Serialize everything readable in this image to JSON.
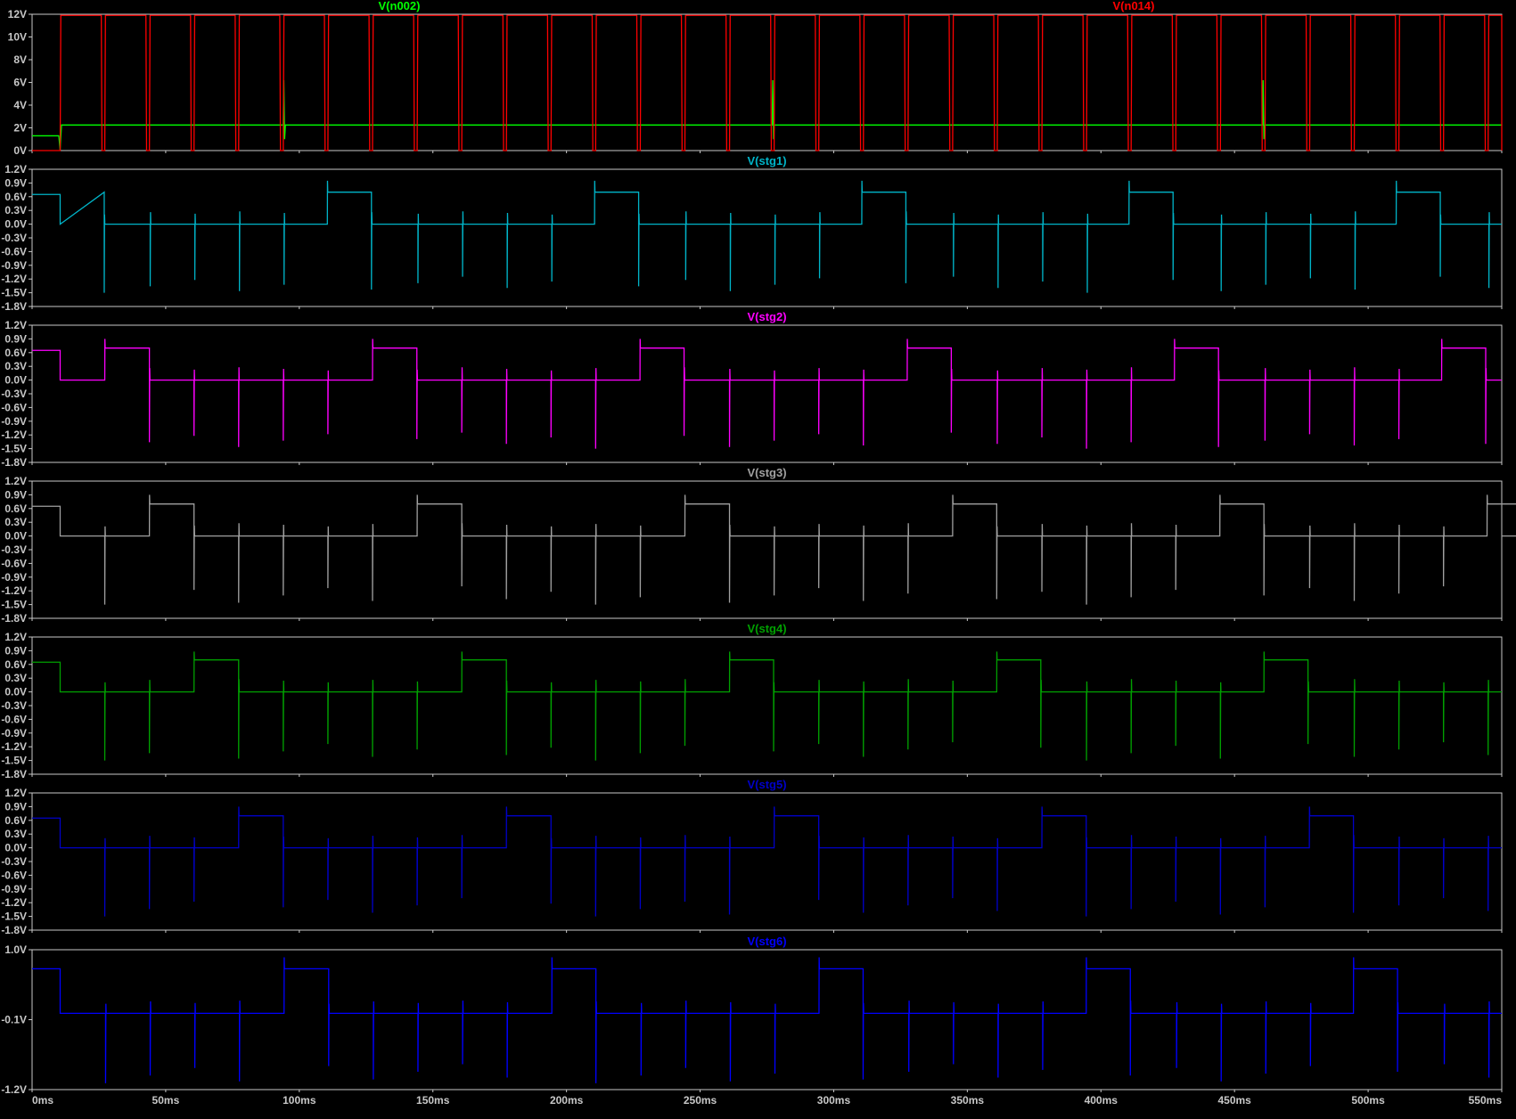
{
  "window": {
    "background": "#000000",
    "frame_color": "#C8C8C8",
    "tick_label_color": "#C8C8C8"
  },
  "chart_data": [
    {
      "type": "line",
      "title": "",
      "xlabel": "",
      "ylabel": "",
      "xlim": [
        0,
        550
      ],
      "ylim": [
        0,
        12
      ],
      "yticks": [
        0,
        2,
        4,
        6,
        8,
        10,
        12
      ],
      "ytick_labels": [
        "0V",
        "2V",
        "4V",
        "6V",
        "8V",
        "10V",
        "12V"
      ],
      "grid": false,
      "legend": "top",
      "series": [
        {
          "name": "V(n002)",
          "color": "#00FF00",
          "points": [
            [
              0,
              1.3
            ],
            [
              10,
              1.3
            ],
            [
              10.5,
              0.05
            ],
            [
              11,
              2.25
            ],
            [
              94,
              2.25
            ],
            [
              94.2,
              6.2
            ],
            [
              94.5,
              1.0
            ],
            [
              94.8,
              2.25
            ],
            [
              277,
              2.25
            ],
            [
              277.2,
              6.2
            ],
            [
              277.5,
              1.0
            ],
            [
              277.8,
              2.25
            ],
            [
              460.5,
              2.25
            ],
            [
              460.7,
              6.2
            ],
            [
              461,
              1.0
            ],
            [
              461.3,
              2.25
            ],
            [
              550,
              2.25
            ]
          ]
        },
        {
          "name": "V(n014)",
          "color": "#FF0000",
          "pulse": {
            "low": 0,
            "high": 11.9,
            "first_rise": 10.5,
            "period": 16.7,
            "width": 15.4,
            "end": 550
          }
        }
      ]
    },
    {
      "type": "line",
      "title": "V(stg1)",
      "xlim": [
        0,
        550
      ],
      "ylim": [
        -1.8,
        1.2
      ],
      "yticks": [
        -1.8,
        -1.5,
        -1.2,
        -0.9,
        -0.6,
        -0.3,
        0.0,
        0.3,
        0.6,
        0.9,
        1.2
      ],
      "ytick_labels": [
        "-1.8V",
        "-1.5V",
        "-1.2V",
        "-0.9V",
        "-0.6V",
        "-0.3V",
        "0.0V",
        "0.3V",
        "0.6V",
        "0.9V",
        "1.2V"
      ],
      "grid": false,
      "series": [
        {
          "name": "V(stg1)",
          "color": "#00B4C8",
          "wave": {
            "baseline": 0.0,
            "pulse_level": 0.7,
            "initial_level": 0.65,
            "initial_end": 10.5,
            "pulse_starts": [
              10.5,
              110.5,
              210.5,
              310.5,
              410.5,
              510.5
            ],
            "pulse_width": 16.5,
            "pulse_overshoot": 0.95,
            "step": 16.7,
            "spike_first": 27.5,
            "spike_min": -1.5,
            "spike_max": -1.15,
            "spike_up": 0.28
          }
        }
      ]
    },
    {
      "type": "line",
      "title": "V(stg2)",
      "xlim": [
        0,
        550
      ],
      "ylim": [
        -1.8,
        1.2
      ],
      "yticks": [
        -1.8,
        -1.5,
        -1.2,
        -0.9,
        -0.6,
        -0.3,
        0.0,
        0.3,
        0.6,
        0.9,
        1.2
      ],
      "ytick_labels": [
        "-1.8V",
        "-1.5V",
        "-1.2V",
        "-0.9V",
        "-0.6V",
        "-0.3V",
        "0.0V",
        "0.3V",
        "0.6V",
        "0.9V",
        "1.2V"
      ],
      "grid": false,
      "series": [
        {
          "name": "V(stg2)",
          "color": "#FF00FF",
          "wave": {
            "baseline": 0.0,
            "pulse_level": 0.7,
            "initial_level": 0.65,
            "initial_end": 10.5,
            "pulse_starts": [
              27.5,
              127.5,
              227.5,
              327.5,
              427.5,
              527.5
            ],
            "pulse_width": 16.5,
            "pulse_overshoot": 0.9,
            "step": 16.7,
            "spike_first": 10.5,
            "spike_min": -1.5,
            "spike_max": -1.15,
            "spike_up": 0.28
          }
        }
      ]
    },
    {
      "type": "line",
      "title": "V(stg3)",
      "xlim": [
        0,
        550
      ],
      "ylim": [
        -1.8,
        1.2
      ],
      "yticks": [
        -1.8,
        -1.5,
        -1.2,
        -0.9,
        -0.6,
        -0.3,
        0.0,
        0.3,
        0.6,
        0.9,
        1.2
      ],
      "ytick_labels": [
        "-1.8V",
        "-1.5V",
        "-1.2V",
        "-0.9V",
        "-0.6V",
        "-0.3V",
        "0.0V",
        "0.3V",
        "0.6V",
        "0.9V",
        "1.2V"
      ],
      "grid": false,
      "series": [
        {
          "name": "V(stg3)",
          "color": "#A0A0A0",
          "wave": {
            "baseline": 0.0,
            "pulse_level": 0.7,
            "initial_level": 0.65,
            "initial_end": 10.5,
            "pulse_starts": [
              44.5,
              144.5,
              244.5,
              344.5,
              444.5,
              544.5
            ],
            "pulse_width": 16.5,
            "pulse_overshoot": 0.9,
            "step": 16.7,
            "spike_first": 10.5,
            "spike_min": -1.5,
            "spike_max": -1.1,
            "spike_up": 0.28
          }
        }
      ]
    },
    {
      "type": "line",
      "title": "V(stg4)",
      "xlim": [
        0,
        550
      ],
      "ylim": [
        -1.8,
        1.2
      ],
      "yticks": [
        -1.8,
        -1.5,
        -1.2,
        -0.9,
        -0.6,
        -0.3,
        0.0,
        0.3,
        0.6,
        0.9,
        1.2
      ],
      "ytick_labels": [
        "-1.8V",
        "-1.5V",
        "-1.2V",
        "-0.9V",
        "-0.6V",
        "-0.3V",
        "0.0V",
        "0.3V",
        "0.6V",
        "0.9V",
        "1.2V"
      ],
      "grid": false,
      "series": [
        {
          "name": "V(stg4)",
          "color": "#00A000",
          "wave": {
            "baseline": 0.0,
            "pulse_level": 0.7,
            "initial_level": 0.65,
            "initial_end": 10.5,
            "pulse_starts": [
              61,
              161,
              261,
              361,
              461
            ],
            "pulse_width": 16.5,
            "pulse_overshoot": 0.88,
            "step": 16.7,
            "spike_first": 10.5,
            "spike_min": -1.5,
            "spike_max": -1.1,
            "spike_up": 0.28
          }
        }
      ]
    },
    {
      "type": "line",
      "title": "V(stg5)",
      "xlim": [
        0,
        550
      ],
      "ylim": [
        -1.8,
        1.2
      ],
      "yticks": [
        -1.8,
        -1.5,
        -1.2,
        -0.9,
        -0.6,
        -0.3,
        0.0,
        0.3,
        0.6,
        0.9,
        1.2
      ],
      "ytick_labels": [
        "-1.8V",
        "-1.5V",
        "-1.2V",
        "-0.9V",
        "-0.6V",
        "-0.3V",
        "0.0V",
        "0.3V",
        "0.6V",
        "0.9V",
        "1.2V"
      ],
      "grid": false,
      "series": [
        {
          "name": "V(stg5)",
          "color": "#0000C8",
          "wave": {
            "baseline": 0.0,
            "pulse_level": 0.7,
            "initial_level": 0.65,
            "initial_end": 10.5,
            "pulse_starts": [
              78,
              178,
              278,
              378,
              478
            ],
            "pulse_width": 16.5,
            "pulse_overshoot": 0.9,
            "step": 16.7,
            "spike_first": 10.5,
            "spike_min": -1.5,
            "spike_max": -1.1,
            "spike_up": 0.28
          }
        }
      ]
    },
    {
      "type": "line",
      "title": "V(stg6)",
      "xlim": [
        0,
        550
      ],
      "ylim": [
        -1.2,
        1.0
      ],
      "yticks": [
        -1.2,
        -0.1,
        1.0
      ],
      "ytick_labels": [
        "-1.2V",
        "-0.1V",
        "1.0V"
      ],
      "grid": false,
      "xticks": [
        0,
        50,
        100,
        150,
        200,
        250,
        300,
        350,
        400,
        450,
        500,
        550
      ],
      "xtick_labels": [
        "0ms",
        "50ms",
        "100ms",
        "150ms",
        "200ms",
        "250ms",
        "300ms",
        "350ms",
        "400ms",
        "450ms",
        "500ms",
        "550ms"
      ],
      "series": [
        {
          "name": "V(stg6)",
          "color": "#0000FF",
          "wave": {
            "baseline": 0.0,
            "pulse_level": 0.7,
            "initial_level": 0.7,
            "initial_end": 10.5,
            "pulse_starts": [
              94.5,
              194.5,
              294.5,
              394.5,
              494.5
            ],
            "pulse_width": 16.5,
            "pulse_overshoot": 0.88,
            "step": 16.7,
            "spike_first": 27.5,
            "spike_min": -1.1,
            "spike_max": -0.8,
            "spike_up": 0.2
          }
        }
      ]
    }
  ]
}
